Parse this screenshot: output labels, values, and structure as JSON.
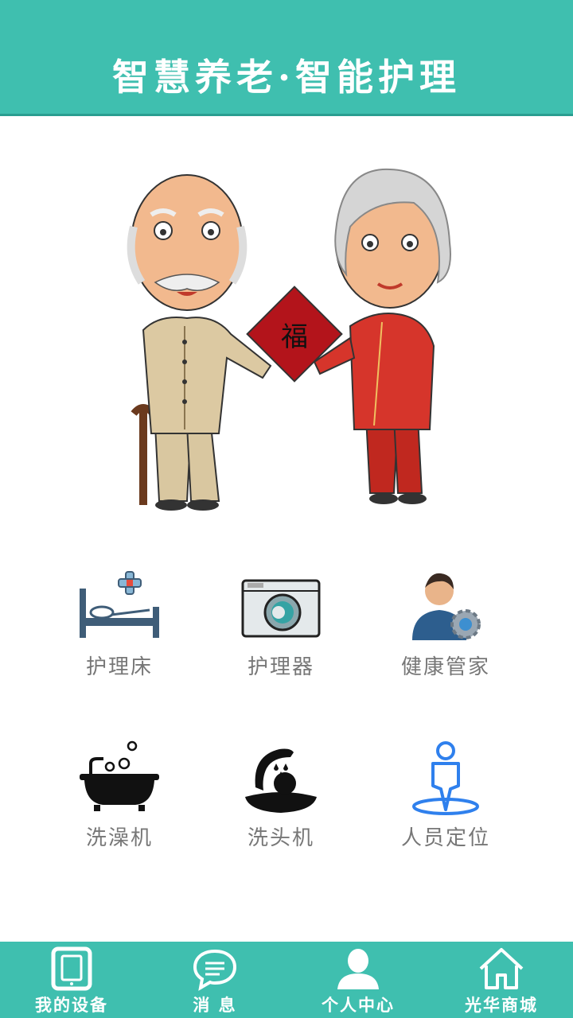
{
  "header": {
    "title": "智慧养老·智能护理"
  },
  "hero": {
    "seal_char": "福"
  },
  "services": [
    {
      "label": "护理床",
      "icon": "nursing-bed-icon"
    },
    {
      "label": "护理器",
      "icon": "nursing-device-icon"
    },
    {
      "label": "健康管家",
      "icon": "health-manager-icon"
    },
    {
      "label": "洗澡机",
      "icon": "bathtub-icon"
    },
    {
      "label": "洗头机",
      "icon": "hair-wash-icon"
    },
    {
      "label": "人员定位",
      "icon": "location-person-icon"
    }
  ],
  "tabs": [
    {
      "label": "我的设备",
      "icon": "tablet-icon"
    },
    {
      "label": "消 息",
      "icon": "chat-bubble-icon"
    },
    {
      "label": "个人中心",
      "icon": "user-icon"
    },
    {
      "label": "光华商城",
      "icon": "home-icon"
    }
  ],
  "colors": {
    "primary": "#3fbfaf",
    "label": "#777777"
  }
}
